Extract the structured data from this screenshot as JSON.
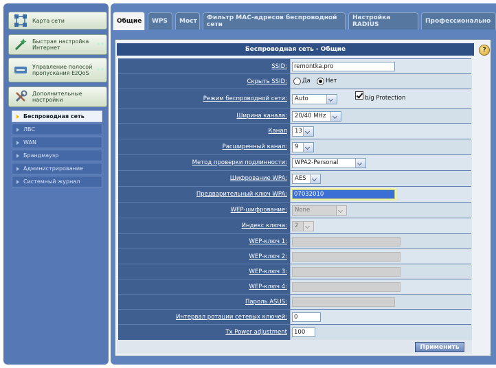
{
  "sidebar": {
    "main_items": [
      {
        "label": "Карта сети",
        "icon": "network-map-icon"
      },
      {
        "label": "Быстрая настройка Интернет",
        "icon": "wizard-wand-icon"
      },
      {
        "label": "Управление полосой пропускания EzQoS",
        "icon": "bandwidth-icon"
      },
      {
        "label": "Дополнительные настройки",
        "icon": "tools-icon"
      }
    ],
    "sub_items": [
      {
        "label": "Беспроводная сеть"
      },
      {
        "label": "ЛВС"
      },
      {
        "label": "WAN"
      },
      {
        "label": "Брандмауэр"
      },
      {
        "label": "Администрирование"
      },
      {
        "label": "Системный журнал"
      }
    ]
  },
  "tabs": [
    {
      "label": "Общие"
    },
    {
      "label": "WPS"
    },
    {
      "label": "Мост"
    },
    {
      "label": "Фильтр MAC-адресов беспроводной сети"
    },
    {
      "label": "Настройка RADIUS"
    },
    {
      "label": "Профессионально"
    }
  ],
  "section_title": "Беспроводная сеть - Общие",
  "help_label": "?",
  "fields": {
    "ssid": {
      "label": "SSID:",
      "value": "remontka.pro"
    },
    "hide_ssid": {
      "label": "Скрыть SSID:",
      "yes": "Да",
      "no": "Нет"
    },
    "mode": {
      "label": "Режим беспроводной сети:",
      "value": "Auto",
      "protection_label": "b/g Protection"
    },
    "width": {
      "label": "Ширина канала:",
      "value": "20/40 MHz"
    },
    "channel": {
      "label": "Канал",
      "value": "13"
    },
    "ext_channel": {
      "label": "Расширенный канал:",
      "value": "9"
    },
    "auth": {
      "label": "Метод проверки подлинности:",
      "value": "WPA2-Personal"
    },
    "wpa_enc": {
      "label": "Шифрование WPA:",
      "value": "AES"
    },
    "wpa_key": {
      "label": "Предварительный ключ WPA:",
      "value": "07032010"
    },
    "wep_enc": {
      "label": "WEP-шифрование:",
      "value": "None"
    },
    "key_index": {
      "label": "Индекс ключа:",
      "value": "2"
    },
    "wep1": {
      "label": "WEP-ключ 1:",
      "value": ""
    },
    "wep2": {
      "label": "WEP-ключ 2:",
      "value": ""
    },
    "wep3": {
      "label": "WEP-ключ 3:",
      "value": ""
    },
    "wep4": {
      "label": "WEP-ключ 4:",
      "value": ""
    },
    "asus_pass": {
      "label": "Пароль ASUS:",
      "value": ""
    },
    "rotation": {
      "label": "Интервал ротации сетевых ключей:",
      "value": "0"
    },
    "tx_power": {
      "label": "Tx Power adjustment",
      "value": "100"
    }
  },
  "apply_label": "Применить"
}
